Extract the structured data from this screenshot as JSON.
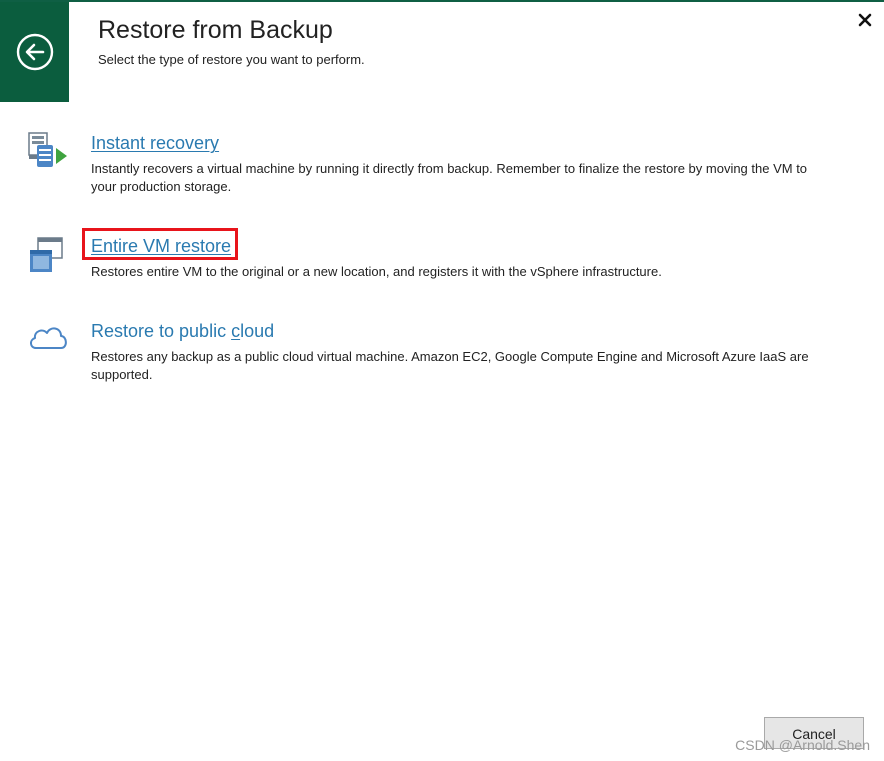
{
  "dialog": {
    "title": "Restore from Backup",
    "subtitle": "Select the type of restore you want to perform.",
    "back_icon": "arrow-left-circle-icon",
    "close_icon": "close-icon",
    "accent_color": "#0b5d3e"
  },
  "options": [
    {
      "title": "Instant recovery",
      "description": "Instantly recovers a virtual machine by running it directly from backup. Remember to finalize the restore by moving the VM to your production storage.",
      "icon": "instant-recovery-icon"
    },
    {
      "title": "Entire VM restore",
      "description": "Restores entire VM to the original or a new location, and registers it with the vSphere infrastructure.",
      "icon": "entire-vm-restore-icon",
      "highlighted": true
    },
    {
      "title_prefix": "Restore to public ",
      "title_accel": "c",
      "title_suffix": "loud",
      "description": "Restores any backup as a public cloud virtual machine. Amazon EC2, Google Compute Engine and Microsoft Azure IaaS are supported.",
      "icon": "cloud-icon"
    }
  ],
  "footer": {
    "cancel_label": "Cancel"
  },
  "watermark": "CSDN @Arnold.Shen",
  "colors": {
    "link": "#2a7ab0",
    "highlight": "#e8141b"
  }
}
